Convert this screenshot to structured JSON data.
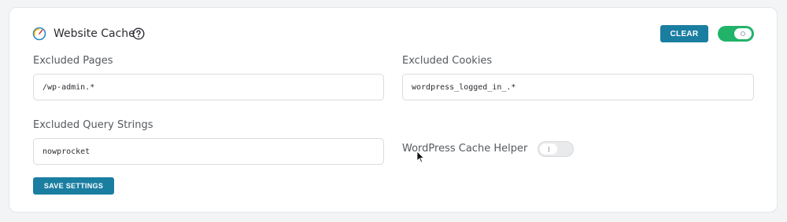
{
  "section": {
    "icon": "speedometer-icon",
    "title": "Website Cache",
    "help_icon": "question-circle-icon",
    "clear_label": "CLEAR",
    "enabled": true
  },
  "fields": {
    "excluded_pages": {
      "label": "Excluded Pages",
      "value": "/wp-admin.*"
    },
    "excluded_cookies": {
      "label": "Excluded Cookies",
      "value": "wordpress_logged_in_.*"
    },
    "excluded_query_strings": {
      "label": "Excluded Query Strings",
      "value": "nowprocket"
    },
    "cache_helper": {
      "label": "WordPress Cache Helper",
      "enabled": false
    }
  },
  "save_label": "SAVE SETTINGS",
  "colors": {
    "accent": "#1a7ea1",
    "toggle_on": "#22b36a",
    "toggle_off": "#e9eaec"
  }
}
